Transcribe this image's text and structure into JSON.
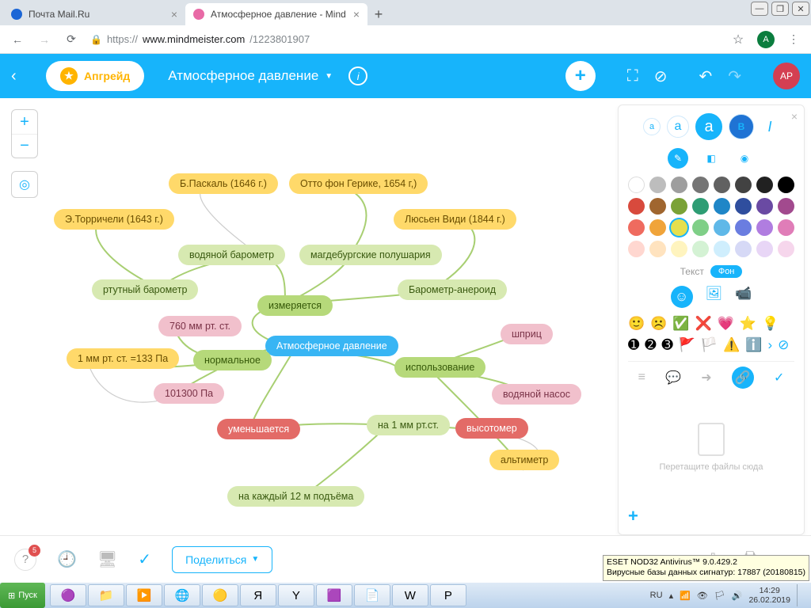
{
  "browser": {
    "tabs": [
      {
        "label": "Почта Mail.Ru",
        "favicon": "#1b66d6"
      },
      {
        "label": "Атмосферное давление - Mind",
        "favicon": "#e86aa6"
      }
    ],
    "url_prefix": "https://",
    "url_host": "www.mindmeister.com",
    "url_path": "/1223801907",
    "avatar_initial": "A"
  },
  "topbar": {
    "upgrade": "Апгрейд",
    "doc_title": "Атмосферное давление",
    "avatar_initials": "АР"
  },
  "nodes": {
    "center": "Атмосферное давление",
    "measured": "измеряется",
    "normal": "нормальное",
    "usage": "использование",
    "decrease": "уменьшается",
    "mmHg760": "760 мм рт. ст.",
    "mmHg1": "1 мм рт. ст. =133 Па",
    "pa101300": "101300 Па",
    "perKm": "на 1 мм рт.ст.",
    "each12": "на каждый 12 м подъёма",
    "water_bar": "водяной барометр",
    "merc_bar": "ртутный барометр",
    "magdeburg": "магдебургские полушария",
    "aneroid": "Барометр-анероид",
    "pascal": "Б.Паскаль (1646 г.)",
    "torricelli": "Э.Торричели (1643 г.)",
    "guericke": "Отто фон Герике, 1654 г,)",
    "vidie": "Люсьен Види (1844 г.)",
    "syringe": "шприц",
    "water_pump": "водяной насос",
    "altimeter": "альтиметр",
    "heightm": "высотомер"
  },
  "panel": {
    "txt_label": "Текст",
    "fon_label": "Фон",
    "drop_hint": "Перетащите файлы сюда",
    "colors_row1": [
      "#ffffff",
      "#bdbdbd",
      "#9e9e9e",
      "#757575",
      "#616161",
      "#424242",
      "#212121",
      "#000000"
    ],
    "colors_row2": [
      "#d84a3d",
      "#a0662f",
      "#7aa236",
      "#2e9d74",
      "#1f86c7",
      "#2f4e9e",
      "#6a4aa3",
      "#a24a8e"
    ],
    "colors_row3": [
      "#ef6b5f",
      "#f0a43a",
      "#e6df4e",
      "#7fcf87",
      "#5fb8e8",
      "#6a7de0",
      "#b07de0",
      "#e07db8"
    ],
    "colors_row4": [
      "#ffd7d0",
      "#ffe3bf",
      "#fff4bf",
      "#d4f2d4",
      "#cfeefd",
      "#d6d9f6",
      "#e8d6f6",
      "#f6d6ec"
    ]
  },
  "bottombar": {
    "share": "Поделиться",
    "help_badge": "5"
  },
  "antivirus": {
    "line1": "ESET NOD32 Antivirus™ 9.0.429.2",
    "line2": "Вирусные базы данных сигнатур: 17887 (20180815)"
  },
  "taskbar": {
    "start": "Пуск",
    "lang": "RU",
    "time": "14:29",
    "date": "26.02.2019"
  }
}
